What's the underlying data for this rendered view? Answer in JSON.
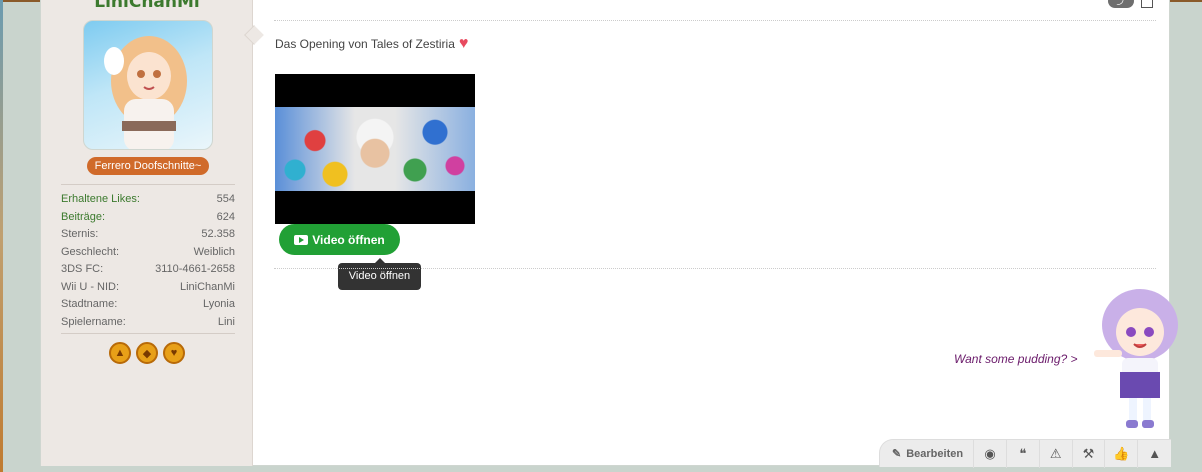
{
  "user": {
    "name": "LiniChanMi",
    "rank": "Ferrero Doofschnitte~",
    "stats": [
      {
        "label": "Erhaltene Likes:",
        "value": "554",
        "highlight": true
      },
      {
        "label": "Beiträge:",
        "value": "624",
        "highlight": true
      },
      {
        "label": "Sternis:",
        "value": "52.358",
        "highlight": false
      },
      {
        "label": "Geschlecht:",
        "value": "Weiblich",
        "highlight": false
      },
      {
        "label": "3DS FC:",
        "value": "3110-4661-2658",
        "highlight": false
      },
      {
        "label": "Wii U - NID:",
        "value": "LiniChanMi",
        "highlight": false
      },
      {
        "label": "Stadtname:",
        "value": "Lyonia",
        "highlight": false
      },
      {
        "label": "Spielername:",
        "value": "Lini",
        "highlight": false
      }
    ],
    "trophy_icons": [
      "tree-icon",
      "bell-icon",
      "heart-icon"
    ]
  },
  "post": {
    "message": "Das Opening von Tales of Zestiria",
    "video_button": "Video öffnen",
    "tooltip": "Video öffnen",
    "signature": "Want some pudding? >"
  },
  "actions": {
    "edit_label": "Bearbeiten"
  },
  "colors": {
    "accent_green": "#21a035",
    "rank_orange": "#d06a2a",
    "username_green": "#3c7a2e"
  }
}
